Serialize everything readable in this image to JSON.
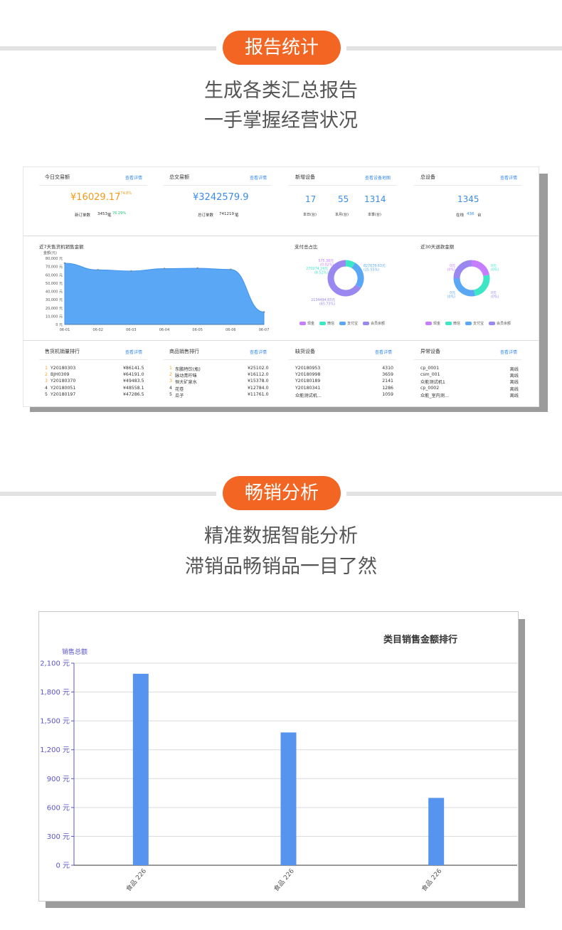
{
  "section1": {
    "badge": "报告统计",
    "tagline1": "生成各类汇总报告",
    "tagline2": "一手掌握经营状况"
  },
  "section2": {
    "badge": "畅销分析",
    "tagline1": "精准数据智能分析",
    "tagline2": "滞销品畅销品一目了然"
  },
  "dashboard": {
    "cards": {
      "today": {
        "title": "今日交易额",
        "link": "查看详情",
        "value": "¥16029.17",
        "pct": "174.8%",
        "sub_label": "新订单数",
        "sub_value": "3453",
        "sub_unit": "笔",
        "sub_pct": "76.29%"
      },
      "total": {
        "title": "总交易额",
        "link": "查看详情",
        "value": "¥3242579.9",
        "sub_label": "总订单数",
        "sub_value": "741219",
        "sub_unit": "笔"
      },
      "new_devices": {
        "title": "新增设备",
        "link": "查看设备地图",
        "v1": "17",
        "l1": "本日(台)",
        "v2": "55",
        "l2": "本月(台)",
        "v3": "1314",
        "l3": "本季(台)"
      },
      "all_devices": {
        "title": "总设备",
        "link": "查看详情",
        "value": "1345",
        "online_label": "在线",
        "online_value": "436",
        "online_unit": "台"
      }
    },
    "sales_chart": {
      "title": "近7天售货机销售金额",
      "unit_label": "金额(元)",
      "y_ticks": [
        "80,000 元",
        "70,000 元",
        "60,000 元",
        "50,000 元",
        "40,000 元",
        "30,000 元",
        "20,000 元",
        "10,000 元",
        "0 元"
      ],
      "x_ticks": [
        "06-01",
        "06-02",
        "06-03",
        "06-04",
        "06-05",
        "06-06",
        "06-07"
      ],
      "values": [
        74000,
        66000,
        64500,
        67500,
        68000,
        66500,
        15000
      ],
      "color": "#5aa8f5"
    },
    "pay_share": {
      "title": "支付总占比",
      "labels": [
        "575.38元 (0.02%)",
        "270274.24元 (8.52%)",
        "827678.63元 (25.55%)",
        "2134494.83元 (65.73%)"
      ],
      "legend": [
        "现金",
        "微信",
        "支付宝",
        "会员余额"
      ],
      "colors": [
        "#c77dff",
        "#3ee6c8",
        "#5aa8f5",
        "#9a88f0"
      ],
      "values": [
        0.02,
        8.52,
        25.55,
        65.73
      ]
    },
    "refund": {
      "title": "近30天退款金额",
      "labels": [
        "0元 (0%)",
        "0元 (0%)",
        "0元 (0%)",
        "0元 (0%)"
      ],
      "legend": [
        "现金",
        "微信",
        "支付宝",
        "会员余额"
      ],
      "colors": [
        "#c77dff",
        "#3ee6c8",
        "#5aa8f5",
        "#9a88f0"
      ]
    },
    "rank_machine": {
      "title": "售货机销量排行",
      "link": "查看详情",
      "rows": [
        [
          "1",
          "Y20180303",
          "¥86141.5"
        ],
        [
          "2",
          "BJH0309",
          "¥64191.0"
        ],
        [
          "3",
          "Y20180370",
          "¥49483.5"
        ],
        [
          "4",
          "Y20180051",
          "¥48558.1"
        ],
        [
          "5",
          "Y20180197",
          "¥47286.5"
        ]
      ]
    },
    "rank_goods": {
      "title": "商品销售排行",
      "link": "查看详情",
      "rows": [
        [
          "1",
          "东鹏特饮(瓶)",
          "¥25102.0"
        ],
        [
          "2",
          "脉动青柠味",
          "¥16112.0"
        ],
        [
          "3",
          "恒大矿泉水",
          "¥15378.0"
        ],
        [
          "4",
          "花卷",
          "¥12784.0"
        ],
        [
          "5",
          "瓜子",
          "¥11761.0"
        ]
      ]
    },
    "out_of_stock": {
      "title": "缺货设备",
      "link": "查看详情",
      "rows": [
        [
          "Y20180953",
          "4310"
        ],
        [
          "Y20180998",
          "3659"
        ],
        [
          "Y20180189",
          "2141"
        ],
        [
          "Y20180341",
          "1286"
        ],
        [
          "众能测试机...",
          "1059"
        ]
      ]
    },
    "abnormal": {
      "title": "异常设备",
      "link": "查看详情",
      "rows": [
        [
          "cp_0001",
          "离线"
        ],
        [
          "csm_001",
          "离线"
        ],
        [
          "众能测试机1",
          "离线"
        ],
        [
          "cp_0002",
          "离线"
        ],
        [
          "众能_室内测...",
          "离线"
        ]
      ]
    }
  },
  "chart_data": {
    "type": "bar",
    "title": "类目销售金额排行",
    "ylabel": "销售总额",
    "categories": [
      "食品 226",
      "食品 226",
      "食品 226"
    ],
    "values": [
      1990,
      1380,
      700
    ],
    "ylim": [
      0,
      2100
    ],
    "y_ticks": [
      "0 元",
      "300 元",
      "600 元",
      "900 元",
      "1,200 元",
      "1,500 元",
      "1,800 元",
      "2,100 元"
    ],
    "grid": true,
    "bar_color": "#5794f0",
    "axis_color": "#5b55c9"
  }
}
